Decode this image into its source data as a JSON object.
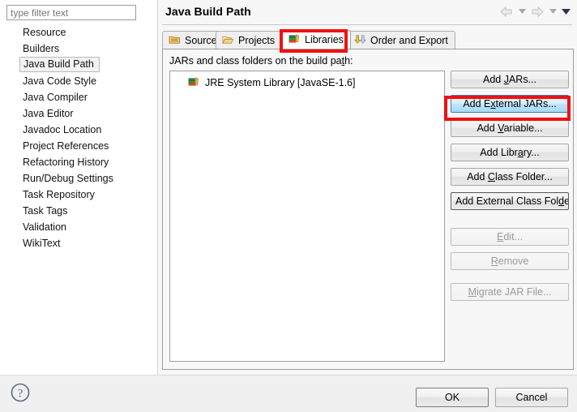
{
  "window": {
    "title": "Java Build Path"
  },
  "sidebar": {
    "filter": {
      "value": "",
      "placeholder": "type filter text"
    },
    "items": [
      {
        "label": "Resource",
        "selected": false
      },
      {
        "label": "Builders",
        "selected": false
      },
      {
        "label": "Java Build Path",
        "selected": true
      },
      {
        "label": "Java Code Style",
        "selected": false
      },
      {
        "label": "Java Compiler",
        "selected": false
      },
      {
        "label": "Java Editor",
        "selected": false
      },
      {
        "label": "Javadoc Location",
        "selected": false
      },
      {
        "label": "Project References",
        "selected": false
      },
      {
        "label": "Refactoring History",
        "selected": false
      },
      {
        "label": "Run/Debug Settings",
        "selected": false
      },
      {
        "label": "Task Repository",
        "selected": false
      },
      {
        "label": "Task Tags",
        "selected": false
      },
      {
        "label": "Validation",
        "selected": false
      },
      {
        "label": "WikiText",
        "selected": false
      }
    ]
  },
  "nav": {
    "back_icon": "back-arrow-icon",
    "back_menu_icon": "chevron-down-icon",
    "forward_icon": "forward-arrow-icon",
    "forward_menu_icon": "chevron-down-icon",
    "more_icon": "chevron-down-icon"
  },
  "tabs": [
    {
      "label": "Source",
      "icon": "source-package-icon",
      "active": false
    },
    {
      "label": "Projects",
      "icon": "open-folder-icon",
      "active": false
    },
    {
      "label": "Libraries",
      "icon": "books-icon",
      "active": true
    },
    {
      "label": "Order and Export",
      "icon": "order-export-icon",
      "active": false
    }
  ],
  "panel": {
    "label_pre": "JARs and class folders on the build pa",
    "label_mnemonic": "t",
    "label_post": "h:",
    "entries": [
      {
        "label": "JRE System Library [JavaSE-1.6]",
        "icon": "books-icon"
      }
    ]
  },
  "buttons": [
    {
      "id": "add-jars",
      "pre": "Add ",
      "mn": "J",
      "post": "ARs...",
      "state": "normal"
    },
    {
      "id": "add-external-jars",
      "pre": "Add E",
      "mn": "x",
      "post": "ternal JARs...",
      "state": "hovered"
    },
    {
      "id": "add-variable",
      "pre": "Add ",
      "mn": "V",
      "post": "ariable...",
      "state": "normal"
    },
    {
      "id": "add-library",
      "pre": "Add Libr",
      "mn": "a",
      "post": "ry...",
      "state": "normal"
    },
    {
      "id": "add-class-folder",
      "pre": "Add ",
      "mn": "C",
      "post": "lass Folder...",
      "state": "normal"
    },
    {
      "id": "add-external-class-folder",
      "pre": "Add External Class Fol",
      "mn": "d",
      "post": "er...",
      "state": "focused"
    },
    {
      "id": "edit",
      "pre": "",
      "mn": "E",
      "post": "dit...",
      "state": "disabled"
    },
    {
      "id": "remove",
      "pre": "",
      "mn": "R",
      "post": "emove",
      "state": "disabled"
    },
    {
      "id": "migrate-jar-file",
      "pre": "",
      "mn": "M",
      "post": "igrate JAR File...",
      "state": "disabled"
    }
  ],
  "footer": {
    "help_icon": "help-question-icon",
    "ok_label": "OK",
    "cancel_label": "Cancel"
  },
  "annotations": {
    "color": "#ee1111",
    "highlight_tab": "Libraries",
    "highlight_button": "Add External JARs..."
  }
}
